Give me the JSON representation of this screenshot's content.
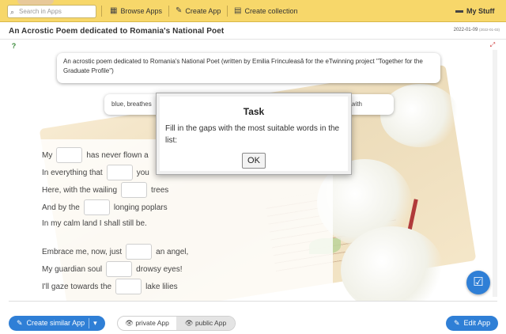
{
  "topnav": {
    "search_placeholder": "Search in Apps",
    "browse": "Browse Apps",
    "create": "Create App",
    "collection": "Create collection",
    "mystuff": "My Stuff"
  },
  "app": {
    "title": "An Acrostic Poem dedicated to Romania's National Poet",
    "date": "2022-01-09",
    "date_small": "(2022-01-03)"
  },
  "intro_text": "An acrostic poem dedicated to Romania's National Poet (written by Emilia Frinculeasă for the eTwinning project \"Together for the Graduate Profile\")",
  "wordbank": {
    "start": "blue, breathes",
    "end": "with"
  },
  "poem": {
    "l1a": "My",
    "l1b": "has never flown a",
    "l2a": "In everything that",
    "l2b": "you",
    "l3a": "Here, with the wailing",
    "l3b": "trees",
    "l4a": "And by the",
    "l4b": "longing poplars",
    "l5": "In my calm land I shall still be.",
    "l6a": "Embrace me, now, just",
    "l6b": "an angel,",
    "l7a": "My guardian soul",
    "l7b": "drowsy eyes!",
    "l8a": "I'll gaze towards the",
    "l8b": "lake lilies"
  },
  "modal": {
    "title": "Task",
    "text": "Fill in the gaps with the most suitable words in the list:",
    "ok": "OK"
  },
  "bottom": {
    "similar": "Create similar App",
    "private": "private App",
    "public": "public App",
    "edit": "Edit App"
  },
  "colors": {
    "topbar": "#f7d76a",
    "accent": "#2f7fd6"
  }
}
